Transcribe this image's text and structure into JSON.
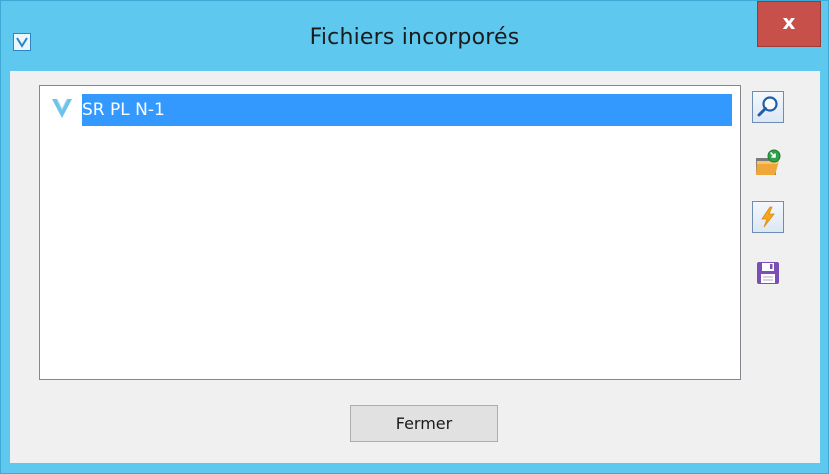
{
  "window": {
    "title": "Fichiers incorporés",
    "close_label": "x"
  },
  "file_list": {
    "items": [
      {
        "label": "SR PL N-1",
        "icon": "v-logo-icon",
        "selected": true
      }
    ]
  },
  "toolbar": {
    "buttons": [
      {
        "name": "view-button",
        "icon": "magnifier-icon"
      },
      {
        "name": "import-button",
        "icon": "folder-import-icon"
      },
      {
        "name": "execute-button",
        "icon": "lightning-icon"
      },
      {
        "name": "save-button",
        "icon": "floppy-disk-icon"
      }
    ]
  },
  "footer": {
    "close_button_label": "Fermer"
  },
  "colors": {
    "titlebar": "#5ec8ef",
    "close_button": "#c7514a",
    "selection": "#3399ff",
    "client_background": "#f0f0f0"
  }
}
